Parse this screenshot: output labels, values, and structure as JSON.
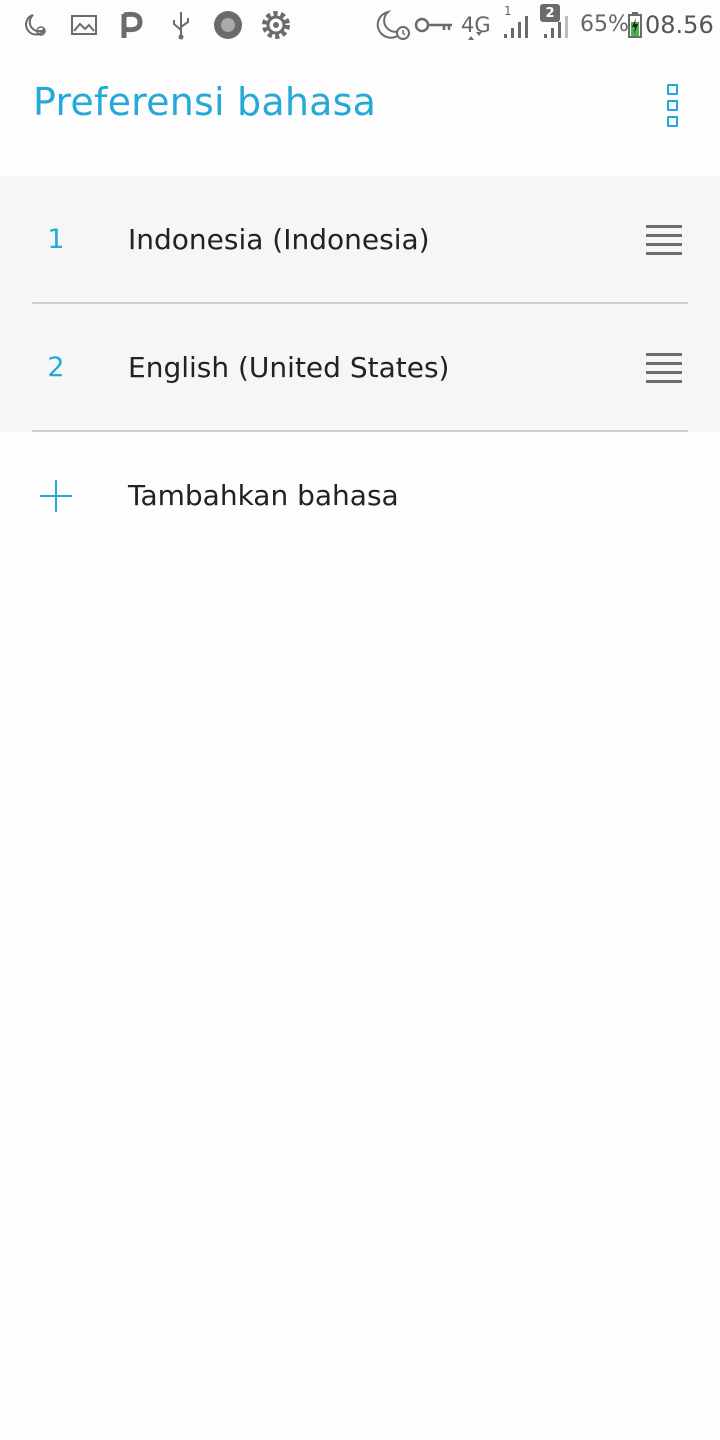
{
  "status_bar": {
    "left_icons": [
      "do-not-disturb-alarm-icon",
      "image-icon",
      "p-app-icon",
      "usb-icon",
      "record-icon",
      "settings-gear-icon"
    ],
    "right_icons": [
      "do-not-disturb-alarm-icon",
      "vpn-key-icon",
      "network-4g-icon",
      "signal-sim1-icon",
      "signal-sim2-icon",
      "battery-charging-icon"
    ],
    "network_type": "4G",
    "sim1_label": "1",
    "sim2_label": "2",
    "battery": "65%",
    "time": "08.56"
  },
  "app_bar": {
    "title": "Preferensi bahasa",
    "menu_icon": "overflow-menu-icon"
  },
  "languages": [
    {
      "index": "1",
      "name": "Indonesia (Indonesia)"
    },
    {
      "index": "2",
      "name": "English (United States)"
    }
  ],
  "add_language": {
    "label": "Tambahkan bahasa",
    "icon": "plus-icon"
  },
  "colors": {
    "accent": "#26a9d8",
    "text": "#222222",
    "list_background": "#f6f6f6",
    "background": "#fdfdfd",
    "battery_green": "#4caf50"
  }
}
